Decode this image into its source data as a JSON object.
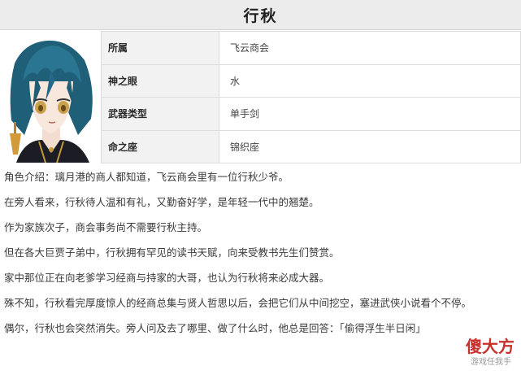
{
  "title": "行秋",
  "info": [
    {
      "label": "所属",
      "value": "飞云商会"
    },
    {
      "label": "神之眼",
      "value": "水"
    },
    {
      "label": "武器类型",
      "value": "单手剑"
    },
    {
      "label": "命之座",
      "value": "锦织座"
    }
  ],
  "paragraphs": [
    "角色介绍：璃月港的商人都知道，飞云商会里有一位行秋少爷。",
    "在旁人看来，行秋待人温和有礼，又勤奋好学，是年轻一代中的翘楚。",
    "作为家族次子，商会事务尚不需要行秋主持。",
    "但在各大巨贾子弟中，行秋拥有罕见的读书天赋，向来受教书先生们赞赏。",
    "家中那位正在向老爹学习经商与持家的大哥，也认为行秋将来必成大器。",
    "殊不知，行秋看完厚度惊人的经商总集与贤人哲思以后，会把它们从中间挖空，塞进武侠小说看个不停。",
    "偶尔，行秋也会突然消失。旁人问及去了哪里、做了什么时，他总是回答：「偷得浮生半日闲」"
  ],
  "watermark": {
    "logo": "傻大方",
    "sub": "游戏任我手"
  }
}
